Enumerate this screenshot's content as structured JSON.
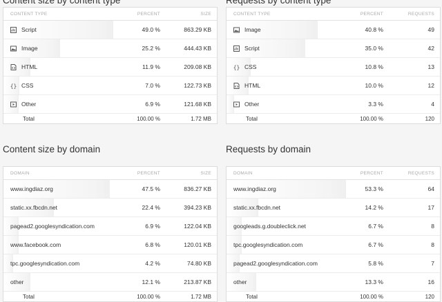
{
  "content_type_size": {
    "title": "Content size by content type",
    "headers": [
      "CONTENT TYPE",
      "PERCENT",
      "SIZE"
    ],
    "rows": [
      {
        "name": "Script",
        "icon": "script-icon",
        "percent": "49.0 %",
        "value": "863.29 KB",
        "fraction": 0.49
      },
      {
        "name": "Image",
        "icon": "image-icon",
        "percent": "25.2 %",
        "value": "444.43 KB",
        "fraction": 0.252
      },
      {
        "name": "HTML",
        "icon": "html-icon",
        "percent": "11.9 %",
        "value": "209.08 KB",
        "fraction": 0.119
      },
      {
        "name": "CSS",
        "icon": "css-icon",
        "percent": "7.0 %",
        "value": "122.73 KB",
        "fraction": 0.07
      },
      {
        "name": "Other",
        "icon": "other-icon",
        "percent": "6.9 %",
        "value": "121.68 KB",
        "fraction": 0.069
      }
    ],
    "total": {
      "name": "Total",
      "percent": "100.00 %",
      "value": "1.72 MB"
    }
  },
  "content_type_requests": {
    "title": "Requests by content type",
    "headers": [
      "CONTENT TYPE",
      "PERCENT",
      "REQUESTS"
    ],
    "rows": [
      {
        "name": "Image",
        "icon": "image-icon",
        "percent": "40.8 %",
        "value": "49",
        "fraction": 0.408
      },
      {
        "name": "Script",
        "icon": "script-icon",
        "percent": "35.0 %",
        "value": "42",
        "fraction": 0.35
      },
      {
        "name": "CSS",
        "icon": "css-icon",
        "percent": "10.8 %",
        "value": "13",
        "fraction": 0.108
      },
      {
        "name": "HTML",
        "icon": "html-icon",
        "percent": "10.0 %",
        "value": "12",
        "fraction": 0.1
      },
      {
        "name": "Other",
        "icon": "other-icon",
        "percent": "3.3 %",
        "value": "4",
        "fraction": 0.033
      }
    ],
    "total": {
      "name": "Total",
      "percent": "100.00 %",
      "value": "120"
    }
  },
  "domain_size": {
    "title": "Content size by domain",
    "headers": [
      "DOMAIN",
      "PERCENT",
      "SIZE"
    ],
    "rows": [
      {
        "name": "www.ingdiaz.org",
        "percent": "47.5 %",
        "value": "836.27 KB",
        "fraction": 0.475
      },
      {
        "name": "static.xx.fbcdn.net",
        "percent": "22.4 %",
        "value": "394.23 KB",
        "fraction": 0.224
      },
      {
        "name": "pagead2.googlesyndication.com",
        "percent": "6.9 %",
        "value": "122.04 KB",
        "fraction": 0.069
      },
      {
        "name": "www.facebook.com",
        "percent": "6.8 %",
        "value": "120.01 KB",
        "fraction": 0.068
      },
      {
        "name": "tpc.googlesyndication.com",
        "percent": "4.2 %",
        "value": "74.80 KB",
        "fraction": 0.042
      },
      {
        "name": "other",
        "percent": "12.1 %",
        "value": "213.87 KB",
        "fraction": 0.121
      }
    ],
    "total": {
      "name": "Total",
      "percent": "100.00 %",
      "value": "1.72 MB"
    }
  },
  "domain_requests": {
    "title": "Requests by domain",
    "headers": [
      "DOMAIN",
      "PERCENT",
      "REQUESTS"
    ],
    "rows": [
      {
        "name": "www.ingdiaz.org",
        "percent": "53.3 %",
        "value": "64",
        "fraction": 0.533
      },
      {
        "name": "static.xx.fbcdn.net",
        "percent": "14.2 %",
        "value": "17",
        "fraction": 0.142
      },
      {
        "name": "googleads.g.doubleclick.net",
        "percent": "6.7 %",
        "value": "8",
        "fraction": 0.067
      },
      {
        "name": "tpc.googlesyndication.com",
        "percent": "6.7 %",
        "value": "8",
        "fraction": 0.067
      },
      {
        "name": "pagead2.googlesyndication.com",
        "percent": "5.8 %",
        "value": "7",
        "fraction": 0.058
      },
      {
        "name": "other",
        "percent": "13.3 %",
        "value": "16",
        "fraction": 0.133
      }
    ],
    "total": {
      "name": "Total",
      "percent": "100.00 %",
      "value": "120"
    }
  }
}
